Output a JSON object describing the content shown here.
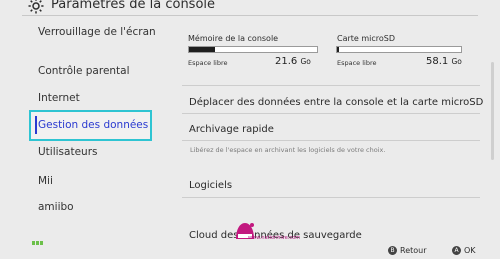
{
  "header": {
    "title": "Paramètres de la console",
    "icon": "gear-icon"
  },
  "sidebar": {
    "items": [
      {
        "label": "Verrouillage de l'écran"
      },
      {
        "label": "Contrôle parental"
      },
      {
        "label": "Internet"
      },
      {
        "label": "Gestion des données",
        "selected": true
      },
      {
        "label": "Utilisateurs"
      },
      {
        "label": "Mii"
      },
      {
        "label": "amiibo"
      }
    ]
  },
  "storage": {
    "console": {
      "title": "Mémoire de la console",
      "free_label": "Espace libre",
      "free_value": "21.6",
      "unit": "Go",
      "used_fraction": 0.2
    },
    "microsd": {
      "title": "Carte microSD",
      "free_label": "Espace libre",
      "free_value": "58.1",
      "unit": "Go",
      "used_fraction": 0.02
    }
  },
  "menu": {
    "move_data": "Déplacer des données entre la console et la carte microSD",
    "quick_archive": "Archivage rapide",
    "quick_archive_desc": "Libérez de l'espace en archivant les logiciels de votre choix.",
    "software": "Logiciels",
    "cloud_save": "Cloud des données de sauvegarde"
  },
  "footer": {
    "back_button": "B",
    "back_label": "Retour",
    "ok_button": "A",
    "ok_label": "OK"
  },
  "watermark": {
    "text": "www.nationhive.com"
  },
  "colors": {
    "selection_border": "#2ec4d2",
    "selection_text": "#2a3ad0",
    "battery": "#6cc04a",
    "watermark": "#b0167c"
  }
}
